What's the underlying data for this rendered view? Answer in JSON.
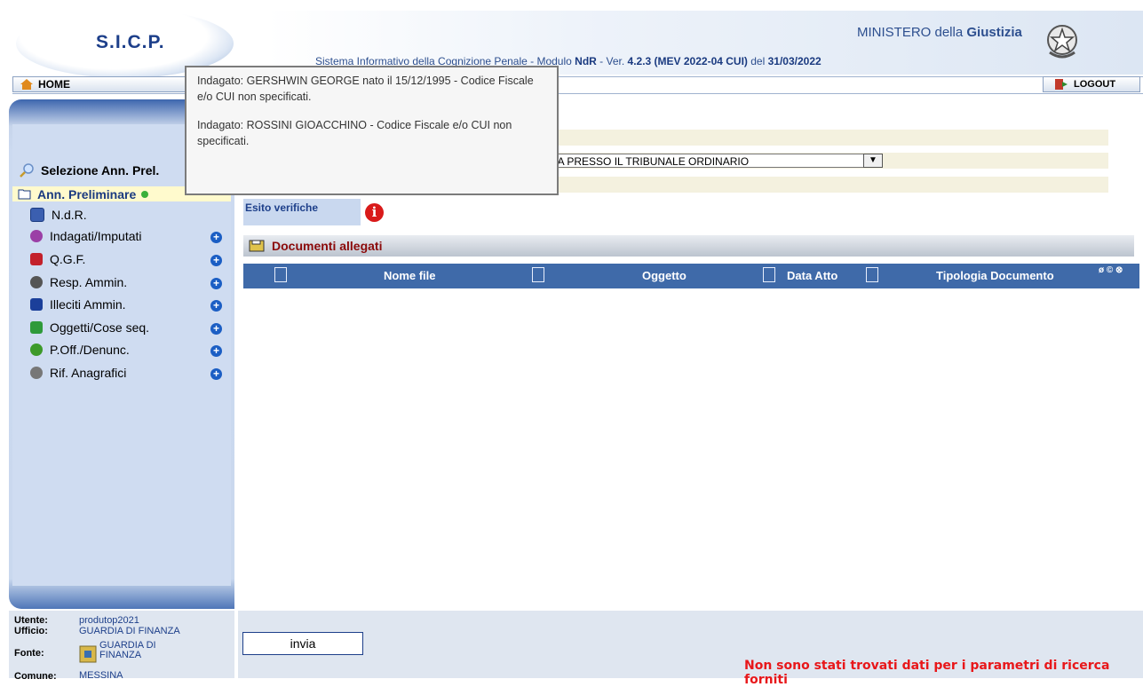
{
  "header": {
    "logo": "S.I.C.P.",
    "system_prefix": "Sistema Informativo della Cognizione Penale - Modulo ",
    "module": "NdR",
    "version_prefix": " - Ver. ",
    "version": "4.2.3 (MEV 2022-04 CUI)",
    "date_prefix": " del ",
    "date": "31/03/2022",
    "ministry_prefix": "MINISTERO della ",
    "ministry_bold": "Giustizia"
  },
  "nav": {
    "home": "HOME",
    "logout": "LOGOUT"
  },
  "sidebar": {
    "selection": "Selezione Ann. Prel.",
    "active": "Ann. Preliminare",
    "items": [
      {
        "label": "N.d.R.",
        "color": "#3b5fb0"
      },
      {
        "label": "Indagati/Imputati",
        "color": "#9b3fa6"
      },
      {
        "label": "Q.G.F.",
        "color": "#c3202b"
      },
      {
        "label": "Resp. Ammin.",
        "color": "#555555"
      },
      {
        "label": "Illeciti Ammin.",
        "color": "#1b3f9a"
      },
      {
        "label": "Oggetti/Cose seq.",
        "color": "#2e9a3a"
      },
      {
        "label": "P.Off./Denunc.",
        "color": "#3d9a2a"
      },
      {
        "label": "Rif. Anagrafici",
        "color": "#777777"
      }
    ]
  },
  "info": {
    "utente_label": "Utente:",
    "utente": "produtop2021",
    "ufficio_label": "Ufficio:",
    "ufficio": "GUARDIA DI FINANZA",
    "fonte_label": "Fonte:",
    "fonte_1": "GUARDIA DI",
    "fonte_2": "FINANZA",
    "comune_label": "Comune:",
    "comune": "MESSINA"
  },
  "form": {
    "procura_value": "CA PRESSO IL TRIBUNALE ORDINARIO",
    "esito_label": "Esito verifiche"
  },
  "documents": {
    "title": "Documenti allegati",
    "columns": [
      "Nome file",
      "Oggetto",
      "Data Atto",
      "Tipologia Documento"
    ],
    "corner_icons": "ø © ⊗"
  },
  "popup": {
    "line1": "Indagato: GERSHWIN GEORGE nato il 15/12/1995 - Codice Fiscale e/o CUI non specificati.",
    "line2": "Indagato: ROSSINI GIOACCHINO - Codice Fiscale e/o CUI non specificati."
  },
  "footer": {
    "submit": "invia",
    "message": "Non sono stati trovati dati per i parametri di ricerca forniti"
  }
}
